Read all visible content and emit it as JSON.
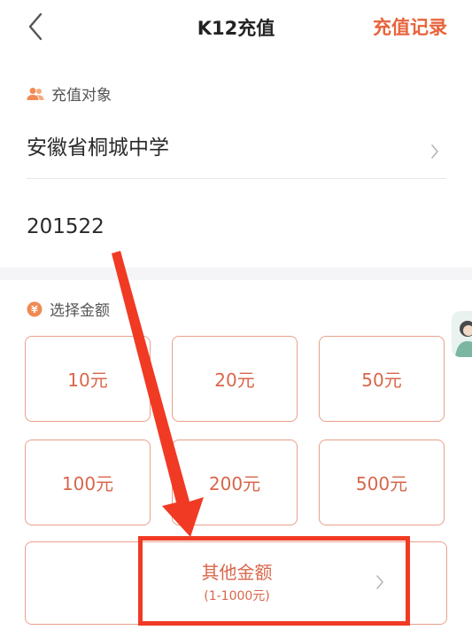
{
  "header": {
    "title": "K12充值",
    "records_label": "充值记录"
  },
  "recharge_target": {
    "label": "充值对象",
    "school": "安徽省桐城中学",
    "student_id": "201522"
  },
  "amount_section": {
    "label": "选择金额",
    "yuan_symbol": "¥",
    "options": [
      "10元",
      "20元",
      "50元",
      "100元",
      "200元",
      "500元"
    ],
    "other": {
      "label": "其他金额",
      "range": "(1-1000元)"
    }
  },
  "colors": {
    "accent": "#e8643c",
    "option_border": "#e9a08a",
    "option_text": "#d9664a",
    "annotation_red": "#f03a24"
  },
  "icons": {
    "back": "chevron-left-icon",
    "target": "users-icon",
    "amount": "yuan-coin-icon",
    "row_arrow": "chevron-right-icon"
  }
}
